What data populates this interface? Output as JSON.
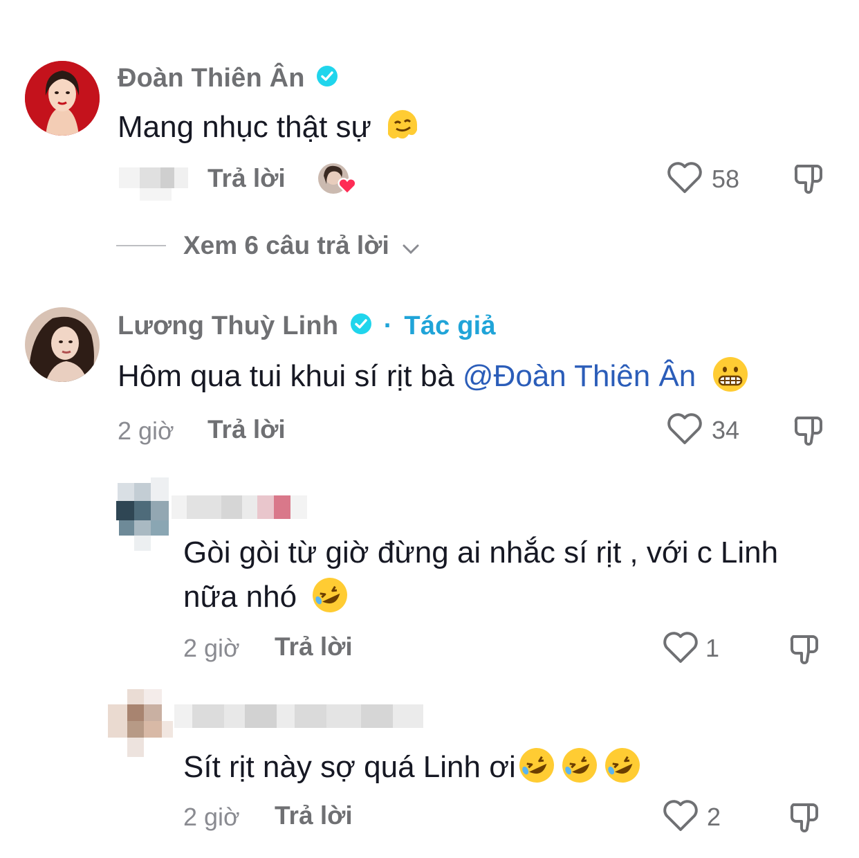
{
  "comments": [
    {
      "username": "Đoàn Thiên Ân",
      "verified": true,
      "text": "Mang nhục thật sự",
      "emoji": "melting-face",
      "time": "",
      "reply_label": "Trả lời",
      "likes": "58",
      "view_replies": "Xem 6 câu trả lời"
    },
    {
      "username": "Lương Thuỳ Linh",
      "verified": true,
      "author_sep": "·",
      "author_tag": "Tác giả",
      "text": "Hôm qua tui khui sí rịt bà ",
      "mention": "@Đoàn Thiên Ân",
      "emoji": "grimacing-face",
      "time": "2 giờ",
      "reply_label": "Trả lời",
      "likes": "34"
    }
  ],
  "replies": [
    {
      "text_line1": "Gòi gòi từ giờ đừng ai nhắc sí rịt , với c Linh",
      "text_line2": "nữa nhó",
      "emoji": "rolling-on-floor-laughing",
      "time": "2 giờ",
      "reply_label": "Trả lời",
      "likes": "1"
    },
    {
      "text": "Sít rịt này sợ quá Linh ơi",
      "emoji": "rolling-on-floor-laughing x3",
      "time": "2 giờ",
      "reply_label": "Trả lời",
      "likes": "2"
    }
  ],
  "colors": {
    "verified": "#20d5ec",
    "author_tag": "#20a4d8",
    "mention": "#2b5db9",
    "heart_badge": "#fe2c55"
  }
}
